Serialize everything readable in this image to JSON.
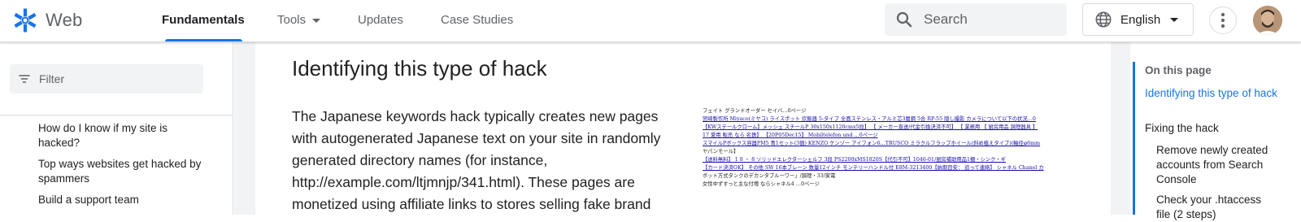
{
  "header": {
    "site_name": "Web",
    "nav": [
      {
        "label": "Fundamentals",
        "active": true
      },
      {
        "label": "Tools",
        "has_dropdown": true
      },
      {
        "label": "Updates"
      },
      {
        "label": "Case Studies"
      }
    ],
    "search_placeholder": "Search",
    "language": "English",
    "accent_color": "#1a73e8"
  },
  "leftnav": {
    "filter_placeholder": "Filter",
    "items": [
      {
        "label": "How do I know if my site is hacked?"
      },
      {
        "label": "Top ways websites get hacked by spammers"
      },
      {
        "label": "Build a support team"
      }
    ]
  },
  "article": {
    "heading": "Identifying this type of hack",
    "paragraph": "The Japanese keywords hack typically creates new pages with autogenerated Japanese text on your site in randomly generated directory names (for instance, http://example.com/ltjmnjp/341.html). These pages are monetized using affiliate links to stores selling fake brand",
    "example_lines": [
      {
        "text": "フェイト グランドオーダー セイバ…0ページ",
        "link": false
      },
      {
        "text": "宮崎製作所 Miyaco(ミヤコ) ライスポット 炊飯器 5-タイプ 全面ステンレス・アルミ芯3層鋼 5合 RP-55 隠し撮影 カメラについて以下の状況…0",
        "link": true
      },
      {
        "text": "【KWステールクローム】メッシュ スチールP 30x150x1120cmx5段】 【 メーカー直送/代金引換決済不可】 【 業務用 【 厨房用品 調理器具 】",
        "link": true
      },
      {
        "text": "17 愛用 販売 なら 名鉄】 【20P05Dec15】 Mobiltelefon und …0ページ",
        "link": true
      },
      {
        "text": "スマイルPボックス容器PM5 青1セット(3個) KENZO ケンゾー アイフォン6…TRUSCO ミラクルフラップホイール(斜め植えタイプ)(軸径φ6mm",
        "link": true
      },
      {
        "text": "ヤパンモール】",
        "link": false
      },
      {
        "text": "【送料無料】 1 8 ・ 8 ソリッドエレクターシェルフ 3段 PS2200xMS1820S【代引不可】1046-01/厨房補助用品1棚・シンク・ギ",
        "link": true
      },
      {
        "text": "【カード決済OK】 その他 SW 16本ブレーン 数量12インチ モンテリーハンドル付 E8M-3213400【納期目安： 追って連絡】 シャネル Chanel カ",
        "link": true
      },
      {
        "text": "ボット方式タンクのデカンタブルーワー」/調理・33/家電",
        "link": false
      },
      {
        "text": "女性中ずすっと主な付増 ならシャネル4 …0ページ",
        "link": false
      }
    ]
  },
  "toc": {
    "title": "On this page",
    "items": [
      {
        "label": "Identifying this type of hack",
        "active": true
      },
      {
        "label": "Fixing the hack"
      },
      {
        "label": "Remove newly created accounts from Search Console",
        "sub": true
      },
      {
        "label": "Check your .htaccess file (2 steps)",
        "sub": true
      }
    ]
  }
}
